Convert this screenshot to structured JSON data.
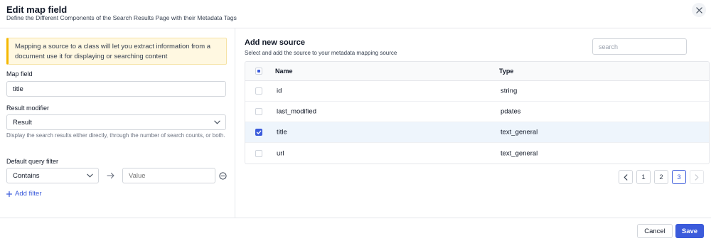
{
  "header": {
    "title": "Edit map field",
    "subtitle": "Define the Different Components of the Search Results Page with their Metadata Tags",
    "close_icon": "close-icon"
  },
  "left": {
    "notice": "Mapping a source to a class will let you extract information from a document use it for displaying or searching content",
    "map_field_label": "Map field",
    "map_field_value": "title",
    "result_modifier_label": "Result modifier",
    "result_modifier_value": "Result",
    "result_modifier_help": "Display the search results either directly, through the number of search counts, or both.",
    "query_filter_label": "Default query filter",
    "query_filter_operator": "Contains",
    "query_filter_value_placeholder": "Value",
    "add_filter_label": "Add filter"
  },
  "right": {
    "title": "Add new source",
    "subtitle": "Select and add the source to your metadata mapping source",
    "search_placeholder": "search",
    "columns": [
      "Name",
      "Type"
    ],
    "rows": [
      {
        "name": "id",
        "type": "string",
        "checked": false
      },
      {
        "name": "last_modified",
        "type": "pdates",
        "checked": false
      },
      {
        "name": "title",
        "type": "text_general",
        "checked": true
      },
      {
        "name": "url",
        "type": "text_general",
        "checked": false
      }
    ],
    "pagination": {
      "prev": "‹",
      "pages": [
        "1",
        "2",
        "3"
      ],
      "current": "3",
      "next": "›"
    }
  },
  "footer": {
    "cancel_label": "Cancel",
    "save_label": "Save"
  },
  "colors": {
    "accent": "#3b5bdb",
    "notice_bg": "#fff8e1",
    "notice_border": "#f5b800",
    "selected_row": "#eef5fc"
  }
}
